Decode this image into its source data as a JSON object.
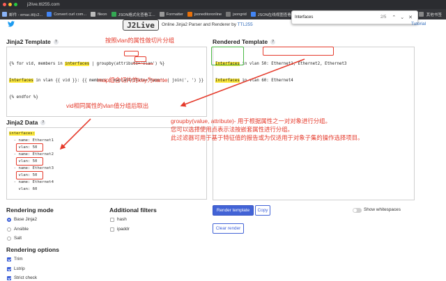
{
  "browser": {
    "url": "j2live.ttl255.com",
    "bookmarks": [
      "邮件 - emac.ttl(c2...",
      "Convert curl com...",
      "fileon",
      "JSON格式化查看工...",
      "Formatter",
      "jsoneditoronline",
      "jsongrid",
      "JSON在线视图查看..."
    ],
    "bookmarks_right": "其他书签",
    "find": {
      "query": "Interfaces",
      "count": "2/5"
    }
  },
  "header": {
    "logo": "J2Live",
    "tagline": "Online Jinja2 Parser and Renderer by",
    "tagline_link": "TTL255",
    "tutorial": "Tutorial"
  },
  "sections": {
    "template_title": "Jinja2 Template",
    "rendered_title": "Rendered Template",
    "data_title": "Jinja2 Data",
    "help": "?"
  },
  "template": {
    "line1": {
      "pre": "{% for vid, members in ",
      "hl": "interfaces",
      "post": " | groupby(attribute='vlan') %}"
    },
    "line2": {
      "hl": "Interfaces",
      "post": " in vlan {{ vid }}: {{ members | map(attribute='name') | join(', ') }}"
    },
    "line3": "{% endfor %}"
  },
  "rendered": {
    "lines": [
      {
        "hl": "Interfaces",
        "post": " in vlan 50: Ethernet1, Ethernet2, Ethernet3"
      },
      {
        "hl": "Interfaces",
        "post": " in vlan 60: Ethernet4"
      }
    ]
  },
  "data": {
    "root_key": "interfaces:",
    "lines": [
      "  - name: Ethernet1",
      "    vlan: 50",
      "  - name: Ethernet2",
      "    vlan: 50",
      "  - name: Ethernet3",
      "    vlan: 50",
      "  - name: Ethernet4",
      "    vlan: 60"
    ]
  },
  "annotations": {
    "a1": "按照vlan的属性做切片分组",
    "a2": "map组合切片的key为name",
    "a3": "vid相同属性的vlan值分组后取出",
    "a4": [
      "groupby(value, attribute)- 用于根据属性之一对对象进行分组。",
      "您可以选择使用点表示法按嵌套属性进行分组。",
      "此过滤器可用于基于特征值的报告或为仅适用于对象子集的操作选择项目。"
    ]
  },
  "rendering_mode": {
    "title": "Rendering mode",
    "options": [
      "Base Jinja2",
      "Ansible",
      "Salt"
    ]
  },
  "additional_filters": {
    "title": "Additional filters",
    "options": [
      "hash",
      "ipaddr"
    ]
  },
  "rendering_options": {
    "title": "Rendering options",
    "options": [
      "Trim",
      "Lstrip",
      "Strict check"
    ]
  },
  "actions": {
    "render": "Render template",
    "copy": "Copy",
    "clear": "Clear render",
    "whitespace": "Show whitespaces"
  },
  "colors": {
    "accent": "#4263d6",
    "annotation": "#e53a2b",
    "highlight": "#ffeb3b",
    "green_box": "#49b843"
  }
}
